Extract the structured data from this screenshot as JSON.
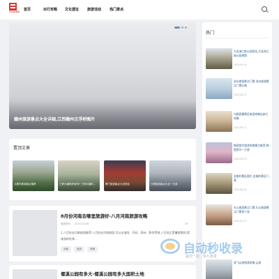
{
  "header": {
    "logo_text": "开封旅游网",
    "nav": [
      "首页",
      "出行攻略",
      "文化遗址",
      "旅游活动",
      "热门景点"
    ]
  },
  "hero": {
    "caption": "赣州旅游景点大全详细,江西赣州古浮桥图片",
    "slide_count": 3,
    "active_slide": 1
  },
  "featured": {
    "title": "置顶文章",
    "items": [
      "九寨沟旅游景点推荐",
      "三峡大瀑布好玩吗? 三峡大瀑布...",
      "厦门旅游景点大全排名",
      "日照旅游景点大全一日游"
    ]
  },
  "articles": [
    {
      "title": "8月份河南去哪里旅游好-八月河南旅游攻略",
      "author": "旅游资讯",
      "date": "2024-10-08",
      "views": "29",
      "excerpt": "1.八月份去河南旅游推荐:八月份去河南旅游,可以去洛阳、开封、郑州、焦作等地,八月份正是暑假期间,是旅游的旺季...",
      "tags": [
        "河南",
        "旅游",
        "攻略"
      ]
    },
    {
      "title": "偃溪公园有多大-偃溪公园有多大面积土地"
    }
  ],
  "sidebar": {
    "heading": "热门",
    "items": [
      {
        "name": "大连海之韵公园地址,大连海之韵公园地图",
        "date": "2024-05-30"
      },
      {
        "name": "沧州旅游景点门票,沧州旅游景点门票价格",
        "date": "2024-06-07"
      },
      {
        "name": "乌镇西栅景区旅游攻略自由行攻略",
        "date": "2024-06-11"
      },
      {
        "name": "韩国首尔旅游攻略景点推荐,韩国首尔一日游",
        "date": "2024-06-03"
      },
      {
        "name": "金佛利景区图片,金佛利景区门票",
        "date": "2024-06-05"
      },
      {
        "name": "孔公旅游景点门票,孔公旅游景点门票多少钱",
        "date": "2024-05-27"
      },
      {
        "name": "双飞云南旅游攻略,云南",
        "date": ""
      }
    ]
  },
  "watermark": {
    "text": "自动秒收录",
    "sub": "提交一次 · 永久收录"
  }
}
